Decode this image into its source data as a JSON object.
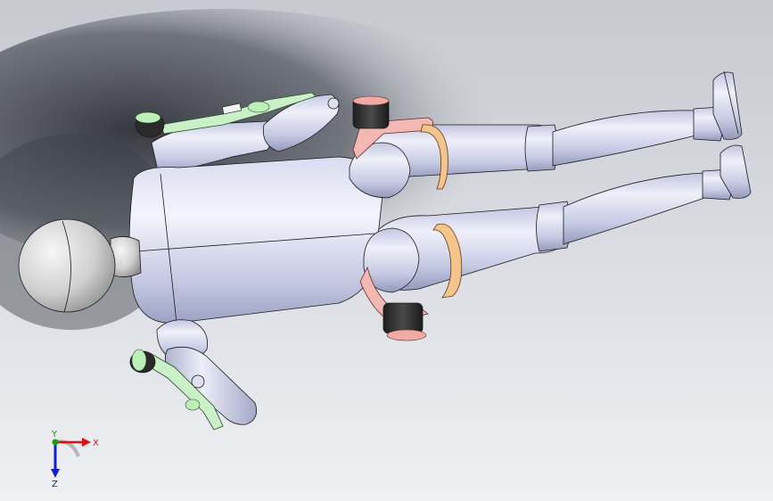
{
  "viewport": {
    "colors": {
      "background_top": "#c9ccd3",
      "background_bottom": "#eceef2",
      "shadow": "#3a3d44",
      "body_light": "#f2f3fb",
      "body_mid": "#c9cde6",
      "body_dark": "#8e93b4",
      "head_light": "#f4f4f4",
      "head_dark": "#9d9d9d",
      "edge": "#1a1a1a",
      "strap_orange": "#f3c48c",
      "strap_pink": "#f2b4b0",
      "strap_green": "#c8f0c4",
      "motor_dark": "#2d2d2d"
    }
  },
  "triad": {
    "x_label": "X",
    "y_label": "Y",
    "z_label": "Z",
    "x_color": "#e01010",
    "y_color": "#10a010",
    "z_color": "#1020d0"
  }
}
